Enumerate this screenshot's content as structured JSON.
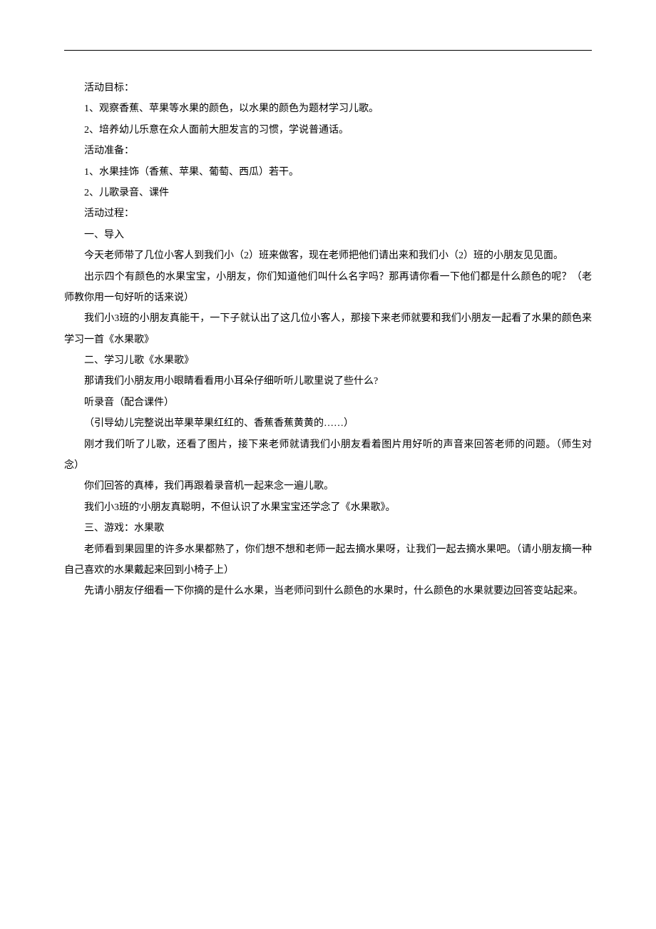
{
  "paragraphs": [
    "活动目标：",
    "1、观察香蕉、苹果等水果的颜色，以水果的颜色为题材学习儿歌。",
    "2、培养幼儿乐意在众人面前大胆发言的习惯，学说普通话。",
    "活动准备：",
    "1、水果挂饰（香蕉、苹果、葡萄、西瓜）若干。",
    "2、儿歌录音、课件",
    "活动过程：",
    "一、导入",
    "今天老师带了几位小客人到我们小（2）班来做客，现在老师把他们请出来和我们小（2）班的小朋友见见面。",
    "出示四个有颜色的水果宝宝，小朋友，你们知道他们叫什么名字吗？那再请你看一下他们都是什么颜色的呢？（老师教你用一句好听的话来说）",
    "我们小3班的小朋友真能干，一下子就认出了这几位小客人，那接下来老师就要和我们小朋友一起看了水果的颜色来学习一首《水果歌》",
    "二、学习儿歌《水果歌》",
    "那请我们小朋友用小眼睛看看用小耳朵仔细听听儿歌里说了些什么?",
    "听录音（配合课件）",
    "（引导幼儿完整说出苹果苹果红红的、香蕉香蕉黄黄的……）",
    "刚才我们听了儿歌，还看了图片，接下来老师就请我们小朋友看着图片用好听的声音来回答老师的问题。（师生对念）",
    "你们回答的真棒，我们再跟着录音机一起来念一遍儿歌。",
    "我们小3班的'小朋友真聪明，不但认识了水果宝宝还学念了《水果歌》。",
    "三、游戏：水果歌",
    "老师看到果园里的许多水果都熟了，你们想不想和老师一起去摘水果呀，让我们一起去摘水果吧。（请小朋友摘一种自己喜欢的水果戴起来回到小椅子上）",
    "先请小朋友仔细看一下你摘的是什么水果，当老师问到什么颜色的水果时，什么颜色的水果就要边回答变站起来。"
  ]
}
